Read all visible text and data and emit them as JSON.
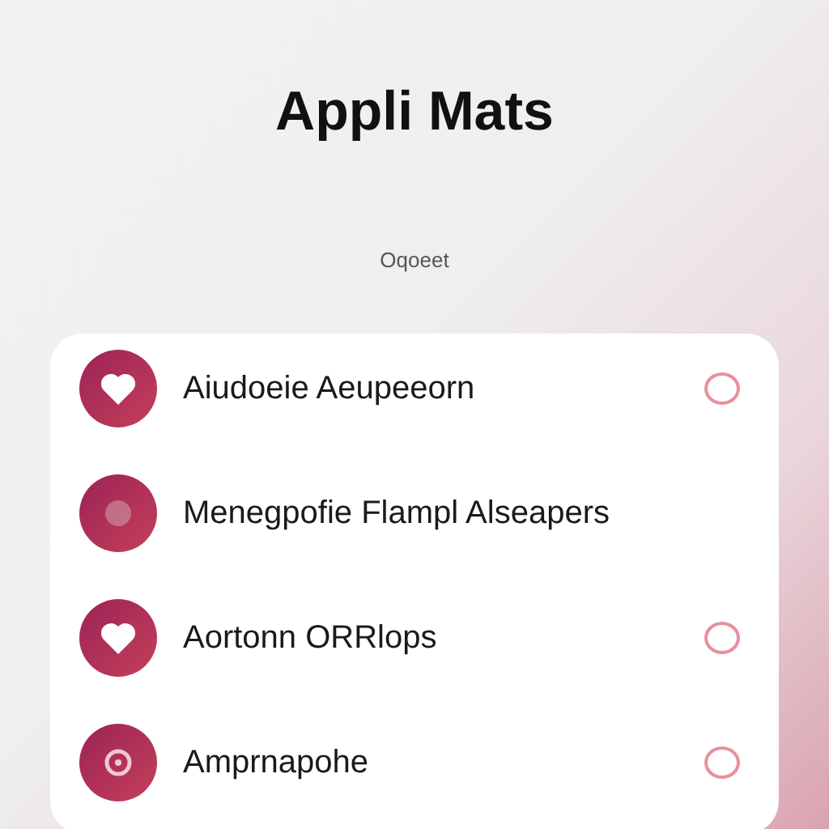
{
  "title": "Appli Mats",
  "pill": "Oqoeet",
  "items": [
    {
      "kind": "heart",
      "label": "Aiudoeie Aeupeeorn",
      "selected": false
    },
    {
      "kind": "blank",
      "label": "Menegpofie Flampl Alseapers"
    },
    {
      "kind": "heart",
      "label": "Aortonn ORRlops",
      "selected": false
    },
    {
      "kind": "dot",
      "label": "Amprnapohe",
      "selected": false
    }
  ]
}
